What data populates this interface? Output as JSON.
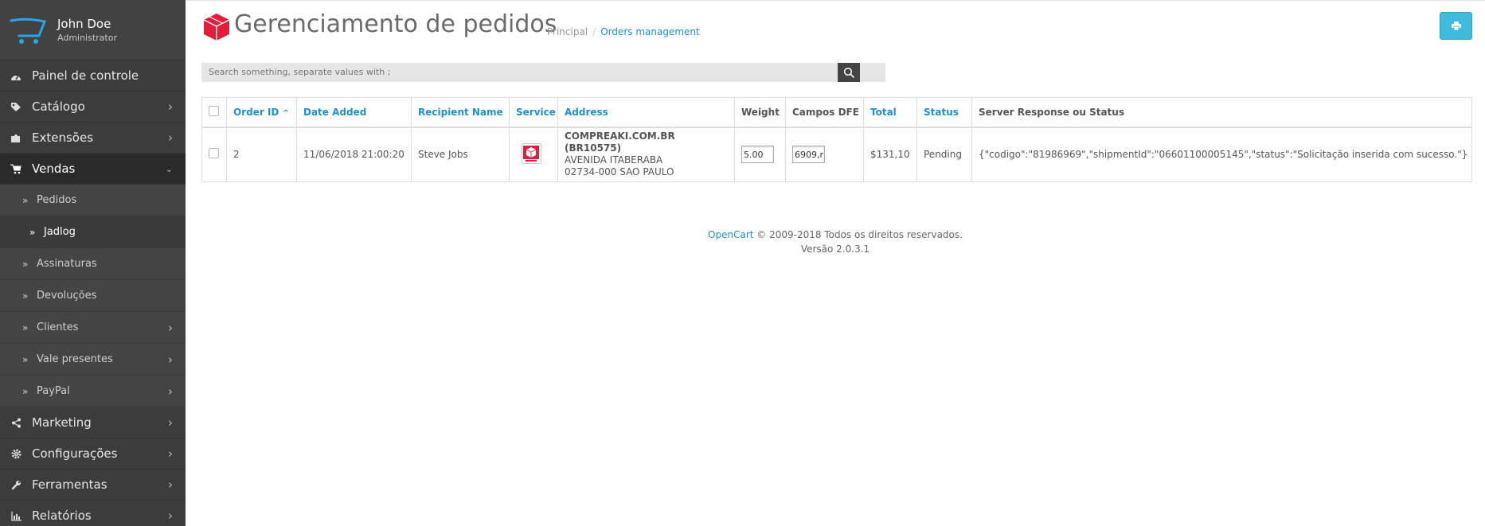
{
  "profile": {
    "name": "John Doe",
    "role": "Administrator"
  },
  "menu": {
    "dashboard": "Painel de controle",
    "catalog": "Catálogo",
    "extensions": "Extensões",
    "sales": "Vendas",
    "sales_sub": {
      "orders": "Pedidos",
      "jadlog": "Jadlog",
      "subscriptions": "Assinaturas",
      "returns": "Devoluções",
      "customers": "Clientes",
      "vouchers": "Vale presentes",
      "paypal": "PayPal"
    },
    "marketing": "Marketing",
    "settings": "Configurações",
    "tools": "Ferramentas",
    "reports": "Relatórios"
  },
  "header": {
    "title": "Gerenciamento de pedidos",
    "breadcrumb_home": "Principal",
    "breadcrumb_sep": "/",
    "breadcrumb_current": "Orders management"
  },
  "search": {
    "placeholder": "Search something, separate values with ;"
  },
  "table": {
    "headers": {
      "order_id": "Order ID",
      "date_added": "Date Added",
      "recipient": "Recipient Name",
      "service": "Service",
      "address": "Address",
      "weight": "Weight",
      "dfe": "Campos DFE",
      "total": "Total",
      "status": "Status",
      "response": "Server Response ou Status"
    },
    "rows": [
      {
        "order_id": "2",
        "date_added": "11/06/2018 21:00:20",
        "recipient": "Steve Jobs",
        "address_line1": "COMPREAKI.COM.BR (BR10575)",
        "address_line2": "AVENIDA ITABERABA",
        "address_line3": "02734-000 SAO PAULO",
        "weight": "5.00",
        "dfe": "6909,r",
        "total": "$131,10",
        "status": "Pending",
        "response": "{\"codigo\":\"81986969\",\"shipmentId\":\"06601100005145\",\"status\":\"Solicitação inserida com sucesso.\"}"
      }
    ]
  },
  "footer": {
    "brand": "OpenCart",
    "copyright": "© 2009-2018 Todos os direitos reservados.",
    "version": "Versão 2.0.3.1"
  },
  "colors": {
    "accent": "#1e91cf",
    "jadlog_red": "#e31e3c",
    "print_button": "#3fbbde",
    "sidebar": "#3c3c3c"
  },
  "icons": {
    "dashboard": "dashboard-icon",
    "catalog": "tag-icon",
    "extensions": "puzzle-icon",
    "sales": "cart-icon",
    "marketing": "share-icon",
    "settings": "gear-icon",
    "tools": "wrench-icon",
    "reports": "bar-chart-icon",
    "print": "print-icon",
    "search": "search-icon",
    "sort": "caret-up-icon"
  }
}
